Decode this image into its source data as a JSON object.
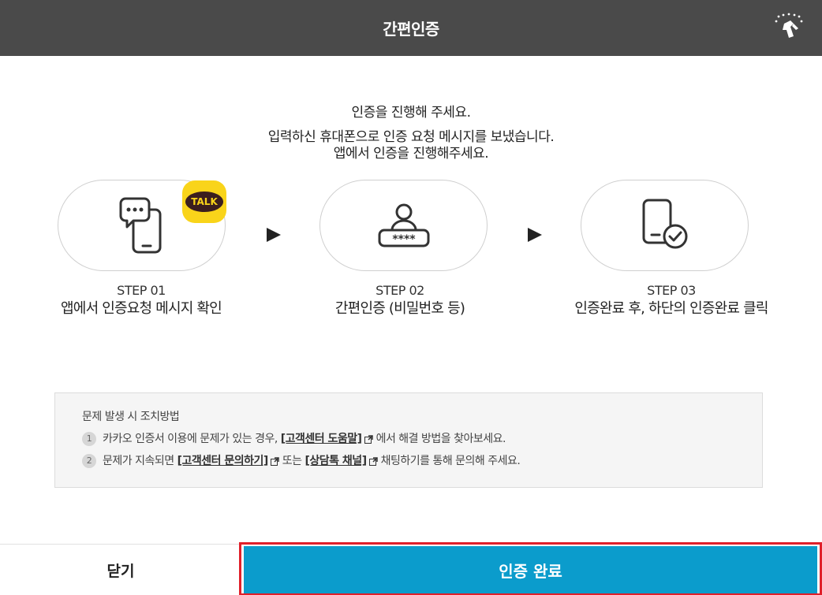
{
  "header": {
    "title": "간편인증"
  },
  "intro": {
    "line1": "인증을 진행해 주세요.",
    "line2": "입력하신 휴대폰으로 인증 요청 메시지를 보냈습니다.",
    "line3": "앱에서 인증을 진행해주세요."
  },
  "steps": [
    {
      "num": "STEP 01",
      "desc": "앱에서 인증요청 메시지 확인",
      "icon": "phone-message-icon"
    },
    {
      "num": "STEP 02",
      "desc": "간편인증 (비밀번호 등)",
      "icon": "user-password-icon"
    },
    {
      "num": "STEP 03",
      "desc": "인증완료 후, 하단의 인증완료 클릭",
      "icon": "phone-check-icon"
    }
  ],
  "talk_badge": "TALK",
  "help": {
    "title": "문제 발생 시 조치방법",
    "items": [
      {
        "num": "1",
        "pre": "카카오 인증서 이용에 문제가 있는 경우,",
        "link": "[고객센터 도움말]",
        "post": "에서 해결 방법을 찾아보세요."
      },
      {
        "num": "2",
        "pre": "문제가 지속되면",
        "link": "[고객센터 문의하기]",
        "mid": "또는",
        "link2": "[상담톡 채널]",
        "post": "채팅하기를 통해 문의해 주세요."
      }
    ]
  },
  "footer": {
    "close_label": "닫기",
    "confirm_label": "인증 완료"
  },
  "colors": {
    "header_bg": "#4a4a4a",
    "confirm_bg": "#0b9ccc",
    "highlight_border": "#e0202a",
    "talk_yellow": "#f9d41a"
  }
}
